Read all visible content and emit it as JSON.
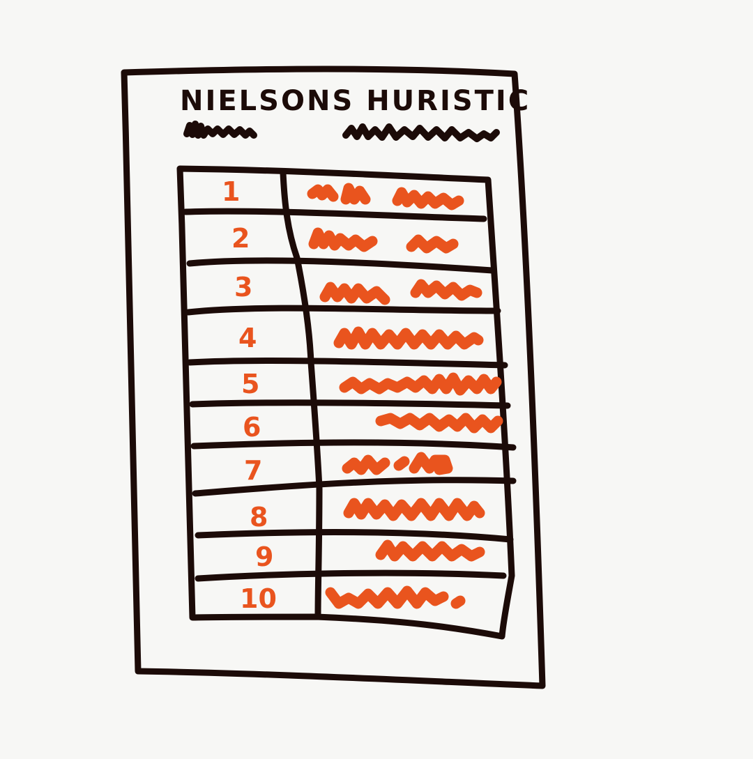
{
  "page": {
    "title": "NIELSONS HURISTIC"
  },
  "table": {
    "numbers": [
      "1",
      "2",
      "3",
      "4",
      "5",
      "6",
      "7",
      "8",
      "9",
      "10"
    ]
  },
  "colors": {
    "background": "#f7f7f5",
    "ink": "#1c0b08",
    "accent": "#e9541e"
  }
}
